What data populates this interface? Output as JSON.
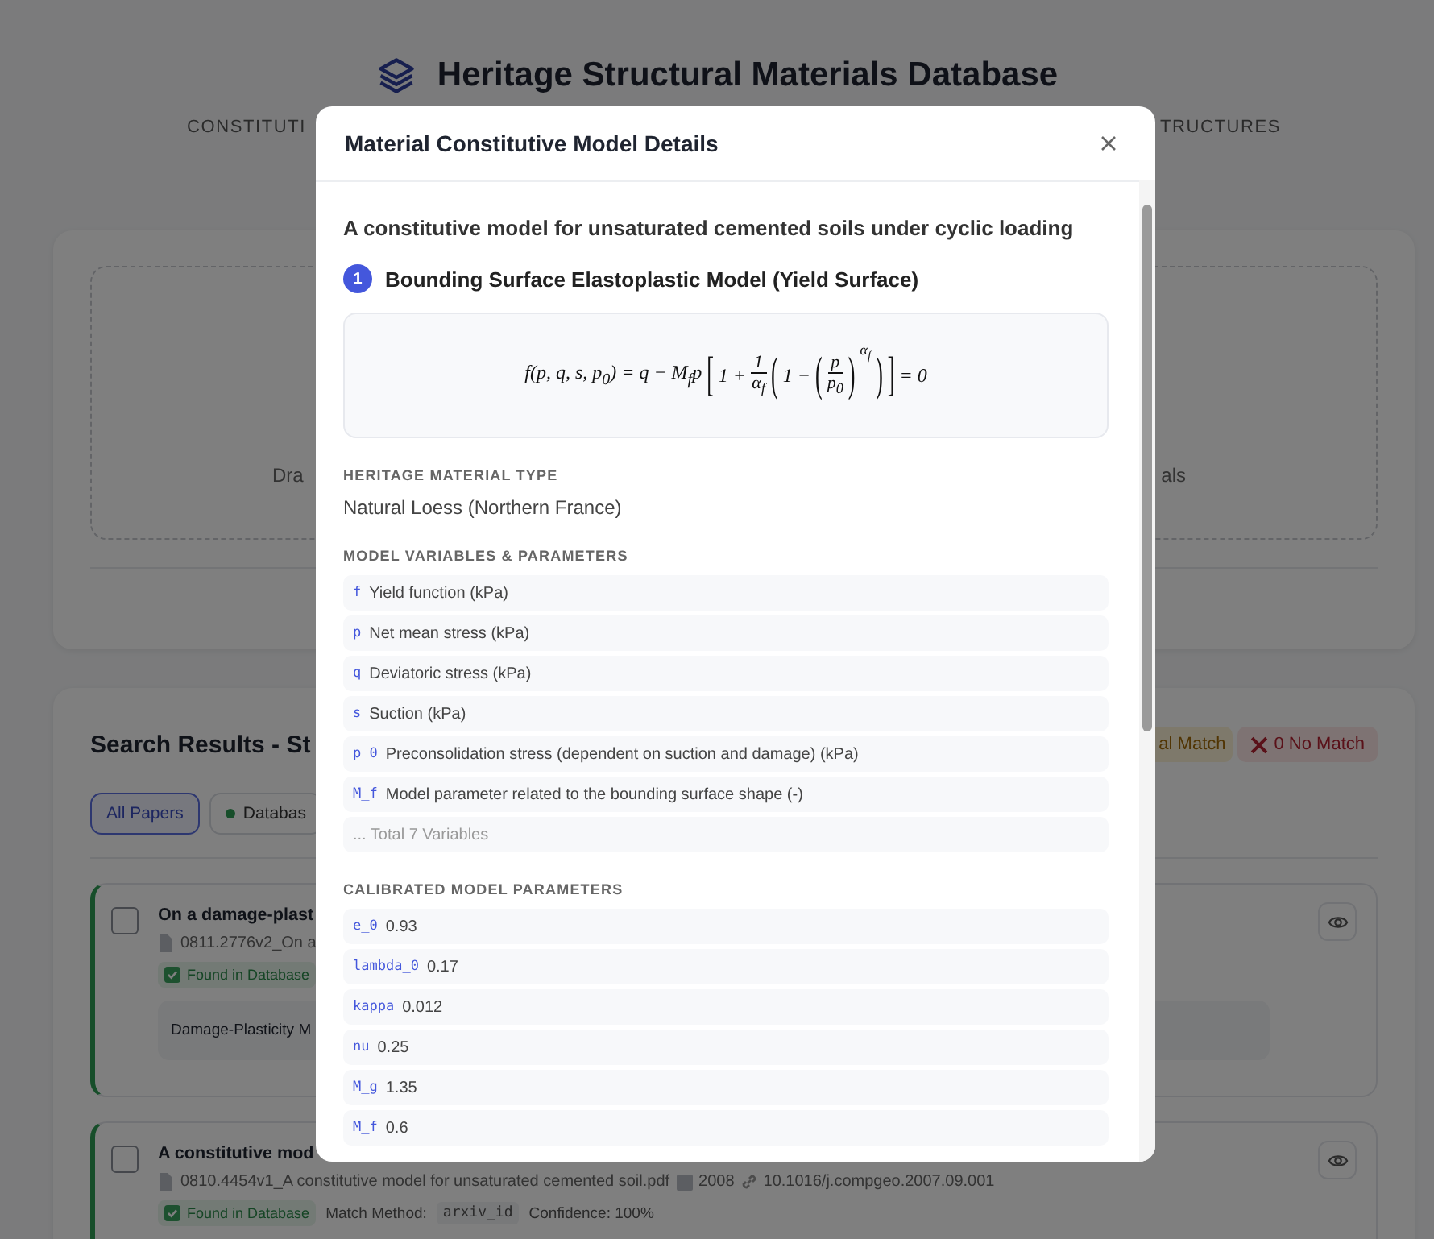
{
  "header": {
    "title": "Heritage Structural Materials Database",
    "nav": [
      "CONSTITUTI",
      "TRUCTURES"
    ]
  },
  "upload": {
    "hint_left": "Dra",
    "hint_right": "als"
  },
  "results": {
    "title": "Search Results - St",
    "summary": [
      {
        "kind": "partial",
        "text": "al Match"
      },
      {
        "kind": "none",
        "text": "0 No Match"
      }
    ],
    "filters": [
      {
        "label": "All Papers",
        "selected": true,
        "dot": false
      },
      {
        "label": "Databas",
        "selected": false,
        "dot": true
      }
    ],
    "papers": [
      {
        "title": "On a damage-plast",
        "checked": false,
        "file": "0811.2776v2_On a",
        "status": "Found in Database",
        "found": true,
        "model": "Damage-Plasticity M"
      },
      {
        "title": "A constitutive mod",
        "checked": false,
        "file": "0810.4454v1_A constitutive model for unsaturated cemented soil.pdf",
        "year": "2008",
        "doi": "10.1016/j.compgeo.2007.09.001",
        "status": "Found in Database",
        "found": true,
        "match_method_label": "Match Method:",
        "match_method": "arxiv_id",
        "confidence": "Confidence: 100%"
      }
    ]
  },
  "modal": {
    "title": "Material Constitutive Model Details",
    "paper_title": "A constitutive model for unsaturated cemented soils under cyclic loading",
    "model": {
      "number": "1",
      "name": "Bounding Surface Elastoplastic Model (Yield Surface)"
    },
    "formula": [
      {
        "kind": "text",
        "text": "f(p, q, s, p$_{0}$) = q − M$_{f}$p"
      },
      {
        "kind": "delim",
        "text": "["
      },
      {
        "kind": "text",
        "text": "1 +"
      },
      {
        "kind": "frac",
        "num": "1",
        "den": "α$_{f}$"
      },
      {
        "kind": "delim",
        "text": "("
      },
      {
        "kind": "text",
        "text": "1 −"
      },
      {
        "kind": "delim",
        "text": "("
      },
      {
        "kind": "frac",
        "num": "p",
        "den": "p$_{0}$"
      },
      {
        "kind": "delim",
        "text": ")"
      },
      {
        "kind": "sup",
        "text": "α$_{f}$"
      },
      {
        "kind": "delim",
        "text": ")"
      },
      {
        "kind": "delim",
        "text": "]"
      },
      {
        "kind": "text",
        "text": "= 0"
      }
    ],
    "material_label": "HERITAGE MATERIAL TYPE",
    "material": "Natural Loess (Northern France)",
    "variables_label": "MODEL VARIABLES & PARAMETERS",
    "variables": [
      {
        "kind": "var",
        "symbol": "f",
        "text": "Yield function (kPa)"
      },
      {
        "kind": "var",
        "symbol": "p",
        "text": "Net mean stress (kPa)"
      },
      {
        "kind": "var",
        "symbol": "q",
        "text": "Deviatoric stress (kPa)"
      },
      {
        "kind": "var",
        "symbol": "s",
        "text": "Suction (kPa)"
      },
      {
        "kind": "var",
        "symbol": "p_0",
        "text": "Preconsolidation stress (dependent on suction and damage) (kPa)"
      },
      {
        "kind": "var",
        "symbol": "M_f",
        "text": "Model parameter related to the bounding surface shape (-)"
      },
      {
        "kind": "more",
        "text": "... Total 7 Variables"
      }
    ],
    "parameters_label": "CALIBRATED MODEL PARAMETERS",
    "parameters": [
      {
        "symbol": "e_0",
        "value": "0.93"
      },
      {
        "symbol": "lambda_0",
        "value": "0.17"
      },
      {
        "symbol": "kappa",
        "value": "0.012"
      },
      {
        "symbol": "nu",
        "value": "0.25"
      },
      {
        "symbol": "M_g",
        "value": "1.35"
      },
      {
        "symbol": "M_f",
        "value": "0.6"
      }
    ]
  }
}
